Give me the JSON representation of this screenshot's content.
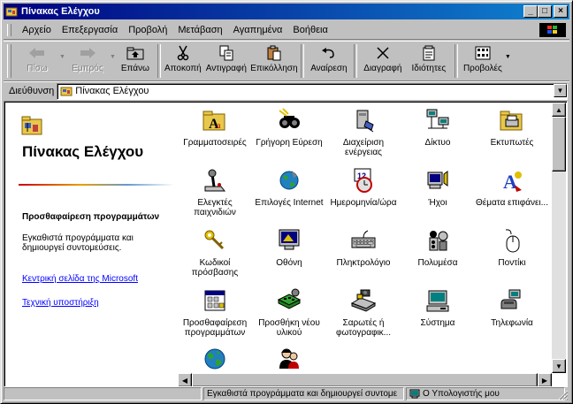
{
  "window": {
    "title": "Πίνακας Ελέγχου"
  },
  "title_buttons": {
    "minimize": "_",
    "maximize": "□",
    "close": "×"
  },
  "menu": [
    {
      "label": "Αρχείο"
    },
    {
      "label": "Επεξεργασία"
    },
    {
      "label": "Προβολή"
    },
    {
      "label": "Μετάβαση"
    },
    {
      "label": "Αγαπημένα"
    },
    {
      "label": "Βοήθεια"
    }
  ],
  "toolbar": [
    {
      "label": "Πίσω",
      "icon": "back-arrow-icon",
      "enabled": false
    },
    {
      "label": "Εμπρός",
      "icon": "forward-arrow-icon",
      "enabled": false
    },
    {
      "label": "Επάνω",
      "icon": "up-folder-icon",
      "enabled": true
    },
    {
      "label": "Αποκοπή",
      "icon": "scissors-icon",
      "enabled": true
    },
    {
      "label": "Αντιγραφή",
      "icon": "copy-icon",
      "enabled": true
    },
    {
      "label": "Επικόλληση",
      "icon": "paste-icon",
      "enabled": true
    },
    {
      "label": "Αναίρεση",
      "icon": "undo-icon",
      "enabled": true
    },
    {
      "label": "Διαγραφή",
      "icon": "delete-x-icon",
      "enabled": true
    },
    {
      "label": "Ιδιότητες",
      "icon": "properties-icon",
      "enabled": true
    },
    {
      "label": "Προβολές",
      "icon": "views-icon",
      "enabled": true
    }
  ],
  "address": {
    "label": "Διεύθυνση",
    "value": "Πίνακας Ελέγχου"
  },
  "left_pane": {
    "title": "Πίνακας Ελέγχου",
    "selected_heading": "Προσθαφαίρεση προγραμμάτων",
    "selected_desc": "Εγκαθιστά προγράμματα και δημιουργεί συντομεύσεις.",
    "link1": "Κεντρική σελίδα της Microsoft",
    "link2": "Τεχνική υποστήριξη"
  },
  "items": [
    {
      "label": "Γραμματοσειρές",
      "icon": "fonts-folder-icon"
    },
    {
      "label": "Γρήγορη Εύρεση",
      "icon": "find-fast-icon"
    },
    {
      "label": "Διαχείριση ενέργειας",
      "icon": "power-management-icon"
    },
    {
      "label": "Δίκτυο",
      "icon": "network-icon"
    },
    {
      "label": "Εκτυπωτές",
      "icon": "printers-folder-icon"
    },
    {
      "label": "Ελεγκτές παιχνιδιών",
      "icon": "joystick-icon"
    },
    {
      "label": "Επιλογές Internet",
      "icon": "internet-options-icon"
    },
    {
      "label": "Ημερομηνία/ώρα",
      "icon": "date-time-icon"
    },
    {
      "label": "Ήχοι",
      "icon": "sounds-icon"
    },
    {
      "label": "Θέματα επιφάνει...",
      "icon": "desktop-themes-icon"
    },
    {
      "label": "Κωδικοί πρόσβασης",
      "icon": "passwords-keys-icon"
    },
    {
      "label": "Οθόνη",
      "icon": "display-icon"
    },
    {
      "label": "Πληκτρολόγιο",
      "icon": "keyboard-icon"
    },
    {
      "label": "Πολυμέσα",
      "icon": "multimedia-icon"
    },
    {
      "label": "Ποντίκι",
      "icon": "mouse-icon"
    },
    {
      "label": "Προσθαφαίρεση προγραμμάτων",
      "icon": "add-remove-programs-icon"
    },
    {
      "label": "Προσθήκη νέου υλικού",
      "icon": "add-new-hardware-icon"
    },
    {
      "label": "Σαρωτές ή φωτογραφικ...",
      "icon": "scanners-cameras-icon"
    },
    {
      "label": "Σύστημα",
      "icon": "system-icon"
    },
    {
      "label": "Τηλεφωνία",
      "icon": "telephony-icon"
    },
    {
      "label": "",
      "icon": "regional-settings-globe-icon"
    },
    {
      "label": "",
      "icon": "users-icon"
    }
  ],
  "status": {
    "text": "Εγκαθιστά προγράμματα και δημιουργεί συντομε",
    "zone": "Ο Υπολογιστής μου"
  },
  "colors": {
    "title_start": "#000080",
    "title_end": "#1084d0",
    "link": "#0000ff"
  }
}
